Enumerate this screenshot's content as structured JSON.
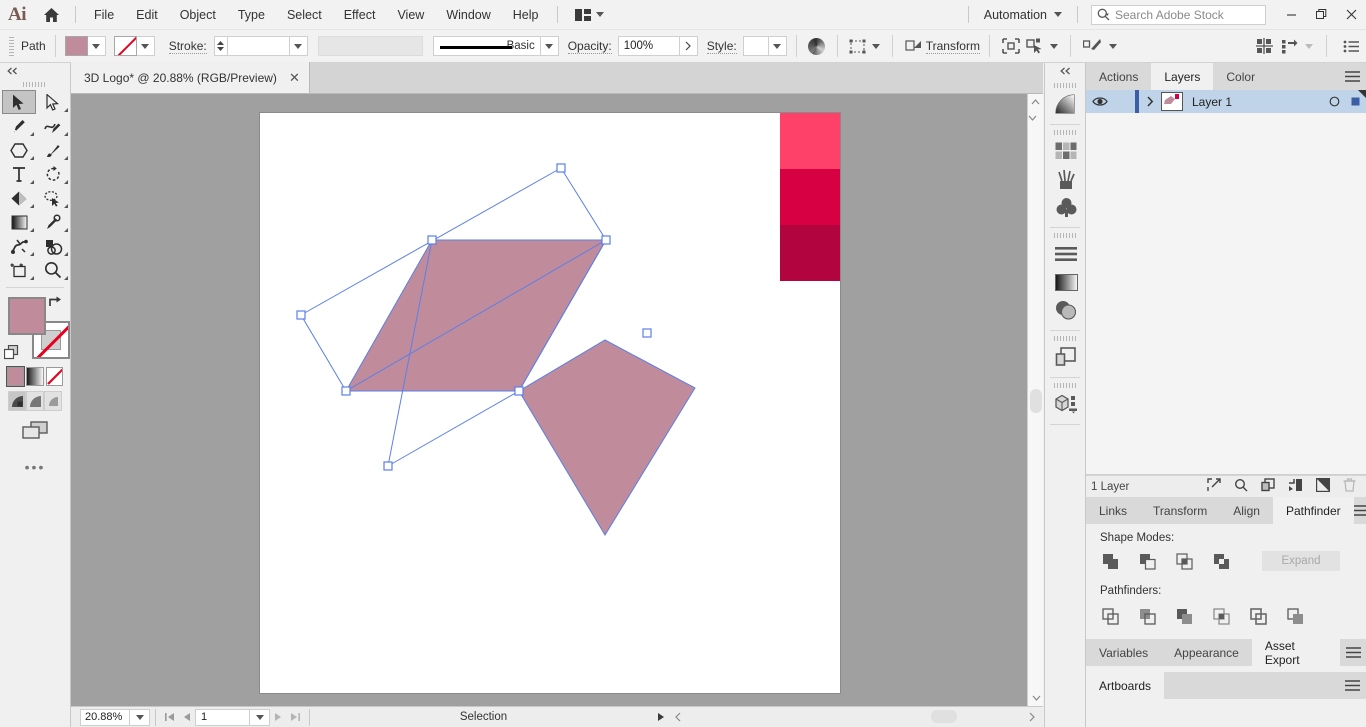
{
  "app": {
    "logo": "Ai",
    "name": "Adobe Illustrator"
  },
  "menubar": {
    "home_icon": "home-icon",
    "items": [
      "File",
      "Edit",
      "Object",
      "Type",
      "Select",
      "Effect",
      "View",
      "Window",
      "Help"
    ],
    "arrange_icon": "arrange-documents-icon",
    "automation_label": "Automation",
    "search_placeholder": "Search Adobe Stock",
    "search_value": "",
    "search_icon": "search-icon",
    "window_minimize": "–",
    "window_restore": "❐",
    "window_close": "✕"
  },
  "controlbar": {
    "object_type": "Path",
    "fill_color": "#c08c9c",
    "stroke_color": "none",
    "stroke_label": "Stroke:",
    "stroke_weight": "",
    "stroke_profile_placeholder": "",
    "brush_definition": "Basic",
    "opacity_label": "Opacity:",
    "opacity_value": "100%",
    "style_label": "Style:",
    "style_value": "",
    "transform_label": "Transform",
    "icons": [
      "recolor-artwork-icon",
      "align-icon",
      "select-similar-icon",
      "isolate-selected-icon",
      "distribute-spacing-icon",
      "snap-to-glyph-icon",
      "document-setup-icon"
    ]
  },
  "toolbar": {
    "collapse_icon": "collapse-panel-icon",
    "tools": [
      {
        "name": "selection-tool",
        "selected": true
      },
      {
        "name": "direct-selection-tool",
        "selected": false
      },
      {
        "name": "pen-tool",
        "selected": false
      },
      {
        "name": "curvature-tool",
        "selected": false
      },
      {
        "name": "shape-tool",
        "selected": false
      },
      {
        "name": "paintbrush-tool",
        "selected": false
      },
      {
        "name": "type-tool",
        "selected": false
      },
      {
        "name": "rotate-tool",
        "selected": false
      },
      {
        "name": "eraser-tool",
        "selected": false
      },
      {
        "name": "shape-builder-tool",
        "selected": false
      },
      {
        "name": "gradient-tool",
        "selected": false
      },
      {
        "name": "eyedropper-tool",
        "selected": false
      },
      {
        "name": "puppet-warp-tool",
        "selected": false
      },
      {
        "name": "blend-tool",
        "selected": false
      },
      {
        "name": "artboard-tool",
        "selected": false
      },
      {
        "name": "zoom-tool",
        "selected": false
      }
    ],
    "fill_color": "#c08c9c",
    "stroke_color": "none",
    "swap_icon": "swap-fill-stroke-icon",
    "default_icon": "default-fill-stroke-icon",
    "fill_modes": [
      "color-fill-mode",
      "gradient-fill-mode",
      "none-fill-mode"
    ],
    "draw_modes": [
      "draw-normal-mode",
      "draw-behind-mode",
      "draw-inside-mode"
    ],
    "screen_mode_icon": "change-screen-mode-icon",
    "more_tools_icon": "edit-toolbar-icon"
  },
  "document": {
    "tab_title": "3D Logo* @ 20.88% (RGB/Preview)",
    "close_icon": "close-tab-icon"
  },
  "canvas": {
    "background": "#a0a0a0",
    "artboard_background": "#ffffff",
    "shape_fill": "#c08c9c",
    "selection_stroke": "#5a7fe8",
    "swatches": [
      "#fe4169",
      "#d60043",
      "#b2043f"
    ]
  },
  "statusbar": {
    "zoom_level": "20.88%",
    "artboard_number": "1",
    "status_text": "Selection",
    "first_icon": "first-artboard-icon",
    "prev_icon": "previous-artboard-icon",
    "next_icon": "next-artboard-icon",
    "last_icon": "last-artboard-icon"
  },
  "iconrail": {
    "collapse_icon": "expand-panels-icon",
    "groups": [
      [
        "gradient-panel-icon"
      ],
      [
        "swatches-panel-icon",
        "brushes-panel-icon",
        "symbols-panel-icon"
      ],
      [
        "stroke-panel-icon",
        "gradient2-panel-icon",
        "transparency-panel-icon"
      ],
      [
        "layers-panel-icon"
      ],
      [
        "3d-and-materials-panel-icon"
      ]
    ]
  },
  "dock": {
    "top_tabs": [
      {
        "label": "Actions",
        "active": false
      },
      {
        "label": "Layers",
        "active": true
      },
      {
        "label": "Color",
        "active": false
      }
    ],
    "menu_icon": "panel-menu-icon",
    "layers": {
      "rows": [
        {
          "name": "Layer 1",
          "visible": true,
          "locked": false,
          "color": "#3d5ea5",
          "expand_icon": "expand-layer-icon",
          "eye_icon": "visibility-eye-icon",
          "target_icon": "target-circle-icon",
          "select_icon": "selection-square-icon"
        }
      ],
      "footer_count": "1 Layer",
      "footer_icons": [
        "locate-object-icon",
        "find-icon",
        "new-sublayer-icon",
        "create-clipping-mask-icon",
        "new-layer-icon",
        "delete-layer-icon"
      ]
    },
    "mid_tabs": [
      {
        "label": "Links",
        "active": false
      },
      {
        "label": "Transform",
        "active": false
      },
      {
        "label": "Align",
        "active": false
      },
      {
        "label": "Pathfinder",
        "active": true
      }
    ],
    "pathfinder": {
      "shape_modes_label": "Shape Modes:",
      "shape_modes": [
        "unite-icon",
        "minus-front-icon",
        "intersect-icon",
        "exclude-icon"
      ],
      "expand_label": "Expand",
      "expand_enabled": false,
      "pathfinders_label": "Pathfinders:",
      "pathfinders": [
        "divide-icon",
        "trim-icon",
        "merge-icon",
        "crop-icon",
        "outline-icon",
        "minus-back-icon"
      ]
    },
    "bottom_tabs": [
      {
        "label": "Variables",
        "active": false
      },
      {
        "label": "Appearance",
        "active": false
      },
      {
        "label": "Asset Export",
        "active": true
      }
    ],
    "artboards_tabs": [
      {
        "label": "Artboards",
        "active": true
      }
    ]
  }
}
